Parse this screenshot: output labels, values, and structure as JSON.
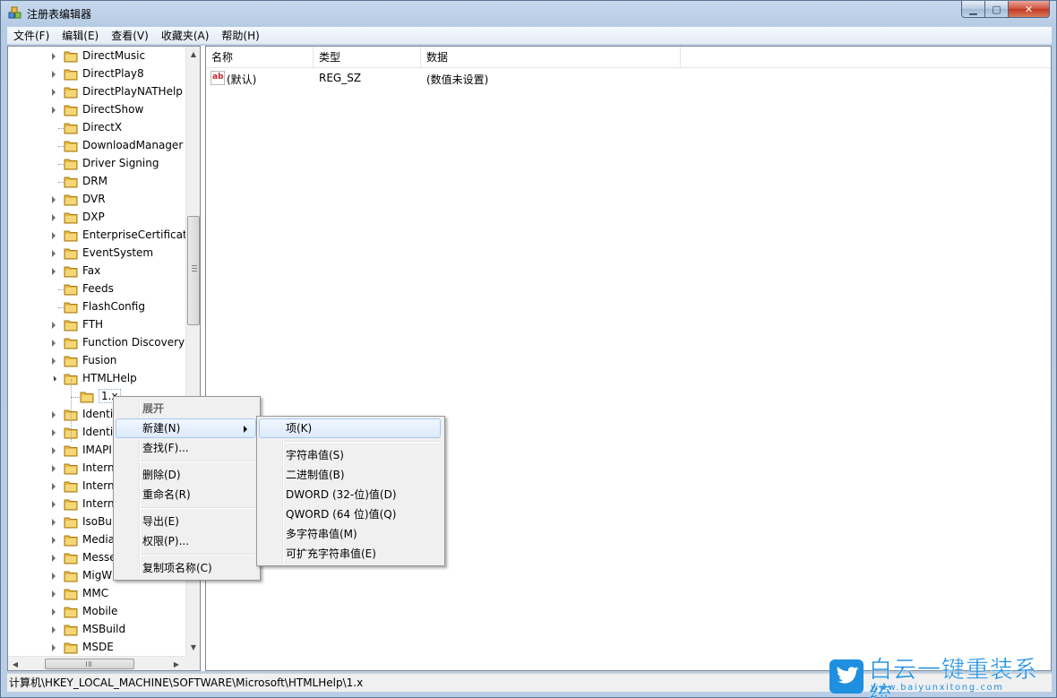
{
  "window": {
    "title": "注册表编辑器",
    "min_glyph": "▁",
    "max_glyph": "▢",
    "close_glyph": "✕"
  },
  "menubar": [
    {
      "label": "文件(F)"
    },
    {
      "label": "编辑(E)"
    },
    {
      "label": "查看(V)"
    },
    {
      "label": "收藏夹(A)"
    },
    {
      "label": "帮助(H)"
    }
  ],
  "tree": {
    "items": [
      {
        "label": "DirectMusic",
        "expandable": true
      },
      {
        "label": "DirectPlay8",
        "expandable": true
      },
      {
        "label": "DirectPlayNATHelp",
        "expandable": true
      },
      {
        "label": "DirectShow",
        "expandable": true
      },
      {
        "label": "DirectX",
        "expandable": false
      },
      {
        "label": "DownloadManager",
        "expandable": false
      },
      {
        "label": "Driver Signing",
        "expandable": false
      },
      {
        "label": "DRM",
        "expandable": false
      },
      {
        "label": "DVR",
        "expandable": true
      },
      {
        "label": "DXP",
        "expandable": true
      },
      {
        "label": "EnterpriseCertificate",
        "expandable": true
      },
      {
        "label": "EventSystem",
        "expandable": true
      },
      {
        "label": "Fax",
        "expandable": true
      },
      {
        "label": "Feeds",
        "expandable": false
      },
      {
        "label": "FlashConfig",
        "expandable": false
      },
      {
        "label": "FTH",
        "expandable": true
      },
      {
        "label": "Function Discovery",
        "expandable": true
      },
      {
        "label": "Fusion",
        "expandable": true
      },
      {
        "label": "HTMLHelp",
        "expandable": true,
        "expanded": true
      },
      {
        "label": "1.x",
        "child": true,
        "selected": true
      },
      {
        "label": "Identi",
        "expandable": true
      },
      {
        "label": "Identi",
        "expandable": true
      },
      {
        "label": "IMAPI",
        "expandable": true
      },
      {
        "label": "Intern",
        "expandable": true
      },
      {
        "label": "Intern",
        "expandable": true
      },
      {
        "label": "Intern",
        "expandable": true
      },
      {
        "label": "IsoBu",
        "expandable": true
      },
      {
        "label": "Media",
        "expandable": true
      },
      {
        "label": "Messe",
        "expandable": true
      },
      {
        "label": "MigW",
        "expandable": true
      },
      {
        "label": "MMC",
        "expandable": true
      },
      {
        "label": "Mobile",
        "expandable": true
      },
      {
        "label": "MSBuild",
        "expandable": true
      },
      {
        "label": "MSDE",
        "expandable": true
      }
    ],
    "scroll_up": "▲",
    "scroll_down": "▼",
    "scroll_left": "◀",
    "scroll_right": "▶"
  },
  "list": {
    "columns": [
      "名称",
      "类型",
      "数据"
    ],
    "rows": [
      {
        "icon": "ab",
        "name": "(默认)",
        "type": "REG_SZ",
        "data": "(数值未设置)"
      }
    ]
  },
  "context_menu": {
    "items": [
      {
        "label": "展开",
        "disabled": true
      },
      {
        "label": "新建(N)",
        "submenu": true,
        "highlighted": true
      },
      {
        "label": "查找(F)..."
      },
      {
        "separator": true
      },
      {
        "label": "删除(D)"
      },
      {
        "label": "重命名(R)"
      },
      {
        "separator": true
      },
      {
        "label": "导出(E)"
      },
      {
        "label": "权限(P)..."
      },
      {
        "separator": true
      },
      {
        "label": "复制项名称(C)"
      }
    ]
  },
  "submenu": {
    "items": [
      {
        "label": "项(K)",
        "highlighted": true
      },
      {
        "separator": true
      },
      {
        "label": "字符串值(S)"
      },
      {
        "label": "二进制值(B)"
      },
      {
        "label": "DWORD (32-位)值(D)"
      },
      {
        "label": "QWORD (64 位)值(Q)"
      },
      {
        "label": "多字符串值(M)"
      },
      {
        "label": "可扩充字符串值(E)"
      }
    ]
  },
  "statusbar": {
    "path": "计算机\\HKEY_LOCAL_MACHINE\\SOFTWARE\\Microsoft\\HTMLHelp\\1.x"
  },
  "watermark": {
    "title": "白云一键重装系统",
    "url": "www.baiyunxitong.com"
  },
  "colors": {
    "folder": "#e8b840",
    "accent": "#1f8fe0",
    "highlight_border": "#a8c8ee"
  }
}
